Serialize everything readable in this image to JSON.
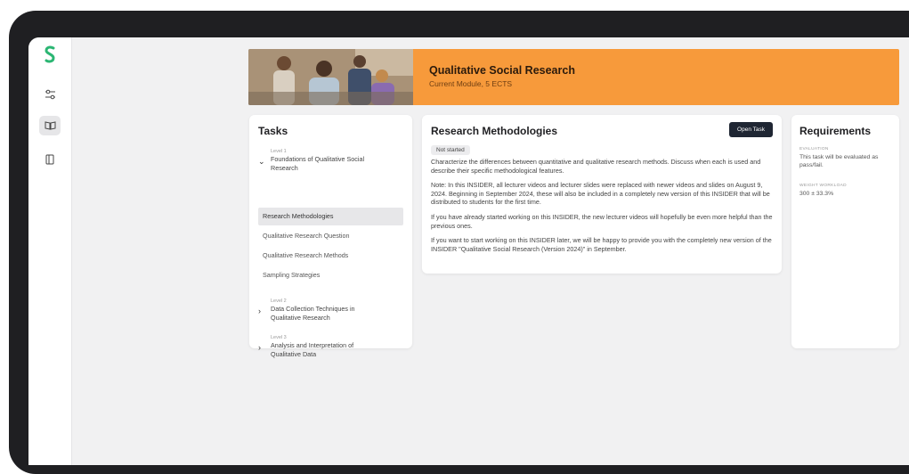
{
  "banner": {
    "title": "Qualitative Social Research",
    "subtitle": "Current Module, 5 ECTS"
  },
  "tasks": {
    "heading": "Tasks",
    "levels": [
      {
        "meta": "Level 1",
        "title": "Foundations of Qualitative Social Research",
        "expanded": true
      },
      {
        "meta": "Level 2",
        "title": "Data Collection Techniques in Qualitative Research",
        "expanded": false
      },
      {
        "meta": "Level 3",
        "title": "Analysis and Interpretation of Qualitative Data",
        "expanded": false
      }
    ],
    "items": [
      "Research Methodologies",
      "Qualitative Research Question",
      "Qualitative Research Methods",
      "Sampling Strategies"
    ]
  },
  "detail": {
    "title": "Research Methodologies",
    "status": "Not started",
    "open_button": "Open Task",
    "paragraphs": [
      "Characterize the differences between quantitative and qualitative research methods. Discuss when each is used and describe their specific methodological features.",
      "Note: In this INSIDER, all lecturer videos and lecturer slides were replaced with newer videos and slides on August 9, 2024. Beginning in September 2024, these will also be included in a completely new version of this INSIDER that will be distributed to students for the first time.",
      "If you have already started working on this INSIDER, the new lecturer videos will hopefully be even more helpful than the previous ones.",
      "If you want to start working on this INSIDER later, we will be happy to provide you with the completely new version of the INSIDER \"Qualitative Social Research (Version 2024)\" in September."
    ]
  },
  "requirements": {
    "heading": "Requirements",
    "evaluation_label": "EVALUATION",
    "evaluation_value": "This task will be evaluated as pass/fail.",
    "weight_label": "WEIGHT WORKLOAD",
    "weight_value": "300 ± 33.3%"
  },
  "colors": {
    "accent": "#f79a3b",
    "brand_green": "#2bb673",
    "button_dark": "#1f2633"
  },
  "icons": [
    "logo-icon",
    "sliders-icon",
    "book-icon",
    "panel-icon",
    "chevron-down-icon",
    "chevron-right-icon"
  ]
}
